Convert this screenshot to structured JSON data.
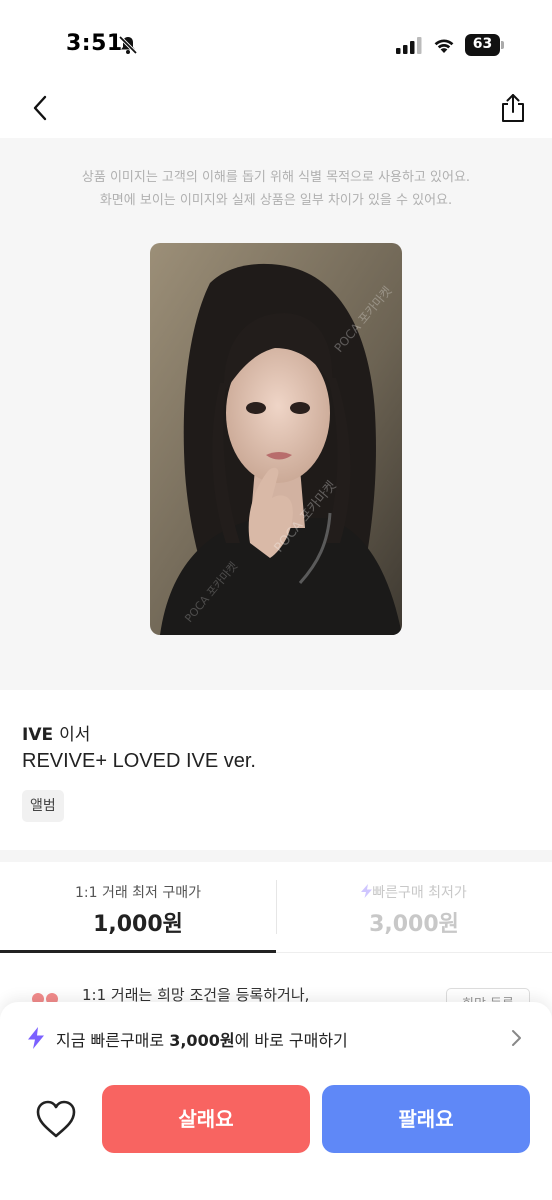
{
  "status_bar": {
    "time": "3:51",
    "battery": "63",
    "icons": [
      "bell-slash-icon",
      "signal-icon",
      "wifi-icon",
      "battery-icon"
    ]
  },
  "nav": {
    "icons": [
      "chevron-left-icon",
      "share-icon"
    ]
  },
  "image_section": {
    "notice_line1": "상품 이미지는 고객의 이해를 돕기 위해 식별 목적으로 사용하고 있어요.",
    "notice_line2": "화면에 보이는 이미지와 실제 상품은 일부 차이가 있을 수 있어요.",
    "watermark": "POCA 포카마켓"
  },
  "product": {
    "artist": "IVE",
    "member": "이서",
    "title": "REVIVE+ LOVED IVE ver.",
    "category": "앨범"
  },
  "price_tabs": [
    {
      "label": "1:1 거래 최저 구매가",
      "price": "1,000원",
      "active": true
    },
    {
      "label": "빠른구매 최저가",
      "price": "3,000원",
      "active": false,
      "icon": "bolt-icon"
    }
  ],
  "peek": {
    "text": "1:1 거래는 희망 조건을 등록하거나,",
    "button": "희망 등록"
  },
  "bottom_sheet": {
    "quick_buy_prefix": "지금 빠른구매로 ",
    "quick_buy_price": "3,000원",
    "quick_buy_suffix": "에 바로 구매하기",
    "buy_label": "살래요",
    "sell_label": "팔래요"
  },
  "colors": {
    "buy": "#f86461",
    "sell": "#5f88f7",
    "quick_buy_accent": "#7b61ff"
  }
}
